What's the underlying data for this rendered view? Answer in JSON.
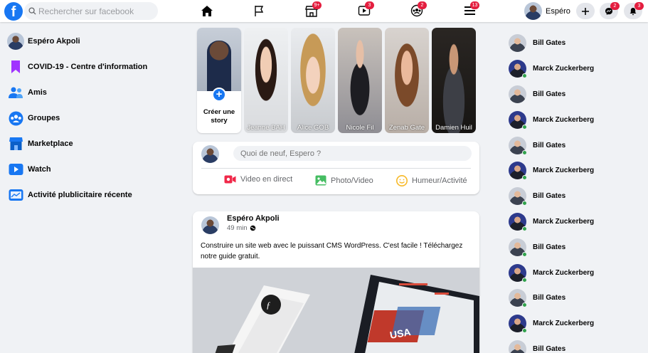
{
  "topbar": {
    "search_placeholder": "Rechercher sur facebook",
    "nav": [
      {
        "icon": "home-icon",
        "badge": ""
      },
      {
        "icon": "flag-icon",
        "badge": ""
      },
      {
        "icon": "store-icon",
        "badge": "9+"
      },
      {
        "icon": "video-icon",
        "badge": "3"
      },
      {
        "icon": "groups-icon",
        "badge": "2"
      },
      {
        "icon": "menu-icon",
        "badge": "13"
      }
    ],
    "profile_name": "Espéro",
    "messenger_badge": "2",
    "notifications_badge": "3"
  },
  "sidebar": {
    "items": [
      {
        "label": "Espéro Akpoli",
        "icon": "avatar"
      },
      {
        "label": "COVID-19 - Centre d'information",
        "icon": "covid-icon"
      },
      {
        "label": "Amis",
        "icon": "friends-icon"
      },
      {
        "label": "Groupes",
        "icon": "groups-icon"
      },
      {
        "label": "Marketplace",
        "icon": "marketplace-icon"
      },
      {
        "label": "Watch",
        "icon": "watch-icon"
      },
      {
        "label": "Activité plublicitaire récente",
        "icon": "ads-icon"
      }
    ]
  },
  "stories": {
    "create_label": "Créer une story",
    "items": [
      {
        "name": "Jeanne BAH"
      },
      {
        "name": "Alice GOB"
      },
      {
        "name": "Nicole Fil"
      },
      {
        "name": "Zenab Gate"
      },
      {
        "name": "Damien Huil"
      }
    ]
  },
  "composer": {
    "placeholder": "Quoi de neuf, Espero ?",
    "actions": [
      "Video en direct",
      "Photo/Video",
      "Humeur/Activité"
    ]
  },
  "post": {
    "author": "Espéro Akpoli",
    "time": "49 min",
    "text": "Construire un site web avec le puissant CMS WordPress. C'est facile ! Téléchargez notre guide gratuit."
  },
  "contacts": [
    {
      "name": "Bill Gates",
      "online": false
    },
    {
      "name": "Marck Zuckerberg",
      "online": true
    },
    {
      "name": "Bill Gates",
      "online": false
    },
    {
      "name": "Marck Zuckerberg",
      "online": true
    },
    {
      "name": "Bill Gates",
      "online": true
    },
    {
      "name": "Marck Zuckerberg",
      "online": true
    },
    {
      "name": "Bill Gates",
      "online": true
    },
    {
      "name": "Marck Zuckerberg",
      "online": true
    },
    {
      "name": "Bill Gates",
      "online": true
    },
    {
      "name": "Marck Zuckerberg",
      "online": true
    },
    {
      "name": "Bill Gates",
      "online": true
    },
    {
      "name": "Marck Zuckerberg",
      "online": true
    },
    {
      "name": "Bill Gates",
      "online": true
    }
  ],
  "colors": {
    "accent": "#1877f2",
    "badge": "#e41e3f",
    "online": "#31a24c"
  }
}
